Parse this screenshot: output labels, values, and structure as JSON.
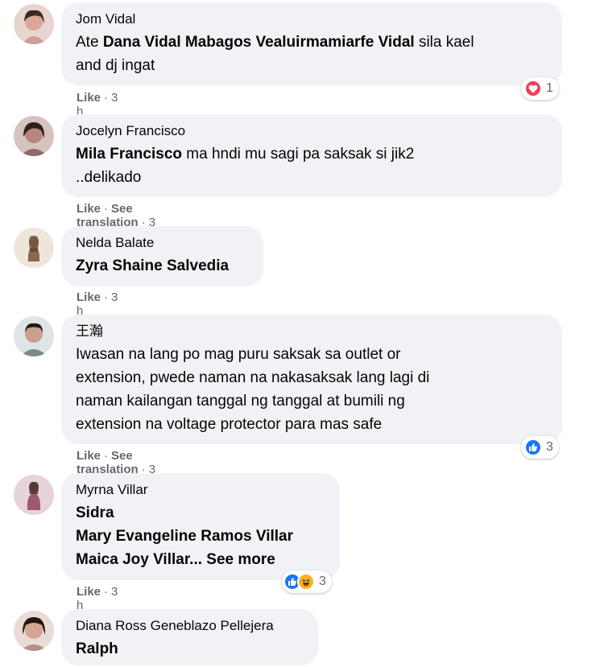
{
  "comments": [
    {
      "author": "Jom Vidal",
      "line1_prefix": "Ate ",
      "line1_mention": "Dana Vidal Mabagos Vealuirmamiarfe Vidal",
      "line1_suffix": " sila kael",
      "line2": "and dj ingat",
      "like": "Like",
      "time": "3 h",
      "reaction_count": "1",
      "reaction_icons": [
        "heart-icon"
      ],
      "avatar_color": "#c9a2a0"
    },
    {
      "author": "Jocelyn Francisco",
      "line1_mention": "Mila Francisco",
      "line1_suffix": " ma hndi mu sagi pa saksak si jik2",
      "line2": "..delikado",
      "like": "Like",
      "see_translation": "See translation",
      "time": "3 h",
      "avatar_color": "#8a6d6b"
    },
    {
      "author": "Nelda Balate",
      "line1_mention": "Zyra Shaine Salvedia",
      "like": "Like",
      "time": "3 h",
      "avatar_color": "#cdb79a"
    },
    {
      "author": "王瀚",
      "lines": [
        "Iwasan na lang po mag puru saksak sa outlet or",
        "extension, pwede naman na nakasaksak lang lagi di",
        "naman kailangan tanggal ng tanggal at bumili ng",
        "extension na voltage protector para mas safe"
      ],
      "like": "Like",
      "see_translation": "See translation",
      "time": "3 h",
      "reaction_count": "3",
      "reaction_icons": [
        "like-icon"
      ],
      "avatar_color": "#7d8a8c"
    },
    {
      "author": "Myrna Villar",
      "mentions": [
        "Sidra",
        "Mary Evangeline Ramos Villar",
        "Maica Joy Villar..."
      ],
      "see_more": " See more",
      "like": "Like",
      "time": "3 h",
      "reaction_count": "3",
      "reaction_icons": [
        "like-icon",
        "haha-icon"
      ],
      "avatar_color": "#9c5a6e"
    },
    {
      "author": "Diana Ross Geneblazo Pellejera",
      "line1_mention": "Ralph",
      "avatar_color": "#b4908a"
    }
  ],
  "colors": {
    "bubble": "#f0f2f5",
    "meta": "#65676b",
    "like_blue": "#1877f2",
    "heart_red": "#f33e58",
    "haha_yellow": "#f7b125"
  }
}
